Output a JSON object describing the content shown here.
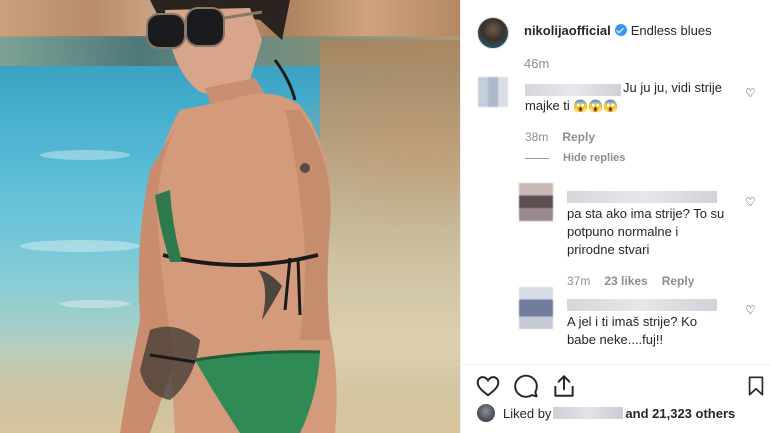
{
  "post": {
    "username": "nikolijaofficial",
    "caption": "Endless blues",
    "time": "46m"
  },
  "comments": [
    {
      "text_line1": "Ju ju ju, vidi strije",
      "text_line2": "majke ti",
      "emoji": "😱😱😱",
      "time": "38m",
      "reply": "Reply",
      "hide_replies": "Hide replies"
    },
    {
      "text_line1": "pa sta ako ima strije? To su",
      "text_line2": "potpuno normalne i",
      "text_line3": "prirodne stvari",
      "time": "37m",
      "likes": "23 likes",
      "reply": "Reply"
    },
    {
      "text_line1": "A jel i ti imaš strije? Ko",
      "text_line2": "babe neke....fuj!!"
    }
  ],
  "likes": {
    "prefix": "Liked by",
    "suffix": "and 21,323 others"
  },
  "colors": {
    "verified": "#3897f0",
    "text": "#262626",
    "muted": "#8e8e8e"
  },
  "icons": [
    "heart-icon",
    "comment-icon",
    "share-icon",
    "bookmark-icon",
    "verified-badge-icon"
  ]
}
